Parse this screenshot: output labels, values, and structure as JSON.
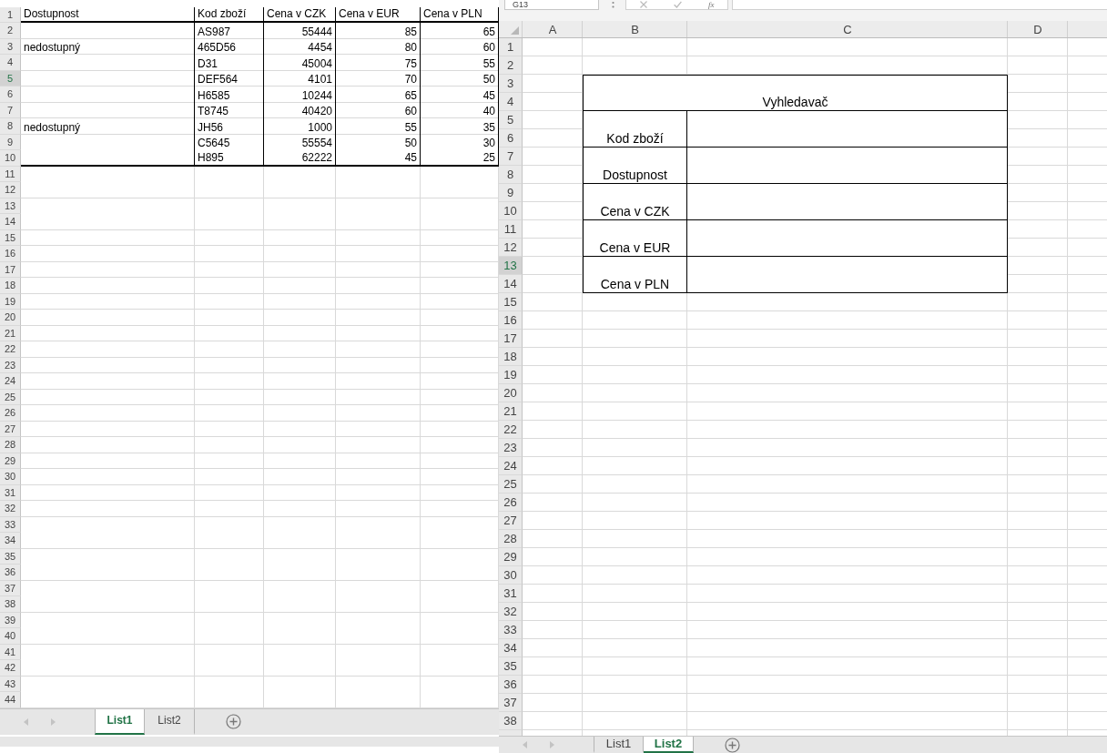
{
  "left_sheet": {
    "row_numbers": [
      {
        "label": "1",
        "selected": false
      },
      {
        "label": "2",
        "selected": false
      },
      {
        "label": "3",
        "selected": false
      },
      {
        "label": "4",
        "selected": false
      },
      {
        "label": "5",
        "selected": true
      },
      {
        "label": "6",
        "selected": false
      },
      {
        "label": "7",
        "selected": false
      },
      {
        "label": "8",
        "selected": false
      },
      {
        "label": "9",
        "selected": false
      },
      {
        "label": "10",
        "selected": false
      },
      {
        "label": "11",
        "selected": false
      },
      {
        "label": "12",
        "selected": false
      },
      {
        "label": "13",
        "selected": false
      },
      {
        "label": "14",
        "selected": false
      },
      {
        "label": "15",
        "selected": false
      },
      {
        "label": "16",
        "selected": false
      },
      {
        "label": "17",
        "selected": false
      },
      {
        "label": "18",
        "selected": false
      },
      {
        "label": "19",
        "selected": false
      },
      {
        "label": "20",
        "selected": false
      },
      {
        "label": "21",
        "selected": false
      },
      {
        "label": "22",
        "selected": false
      },
      {
        "label": "23",
        "selected": false
      },
      {
        "label": "24",
        "selected": false
      },
      {
        "label": "25",
        "selected": false
      },
      {
        "label": "26",
        "selected": false
      },
      {
        "label": "27",
        "selected": false
      },
      {
        "label": "28",
        "selected": false
      },
      {
        "label": "29",
        "selected": false
      },
      {
        "label": "30",
        "selected": false
      },
      {
        "label": "31",
        "selected": false
      },
      {
        "label": "32",
        "selected": false
      },
      {
        "label": "33",
        "selected": false
      },
      {
        "label": "34",
        "selected": false
      },
      {
        "label": "35",
        "selected": false
      },
      {
        "label": "36",
        "selected": false
      },
      {
        "label": "37",
        "selected": false
      },
      {
        "label": "38",
        "selected": false
      },
      {
        "label": "39",
        "selected": false
      },
      {
        "label": "40",
        "selected": false
      },
      {
        "label": "41",
        "selected": false
      },
      {
        "label": "42",
        "selected": false
      },
      {
        "label": "43",
        "selected": false
      },
      {
        "label": "44",
        "selected": false
      }
    ],
    "table": {
      "columns": [
        "Dostupnost",
        "Kod zboží",
        "Cena v CZK",
        "Cena v EUR",
        "Cena v PLN"
      ],
      "rows": [
        {
          "code": "AS987",
          "price_czk": "55444",
          "price_eur": "85",
          "price_pln": "65"
        },
        {
          "availability": "nedostupný",
          "code": "465D56",
          "price_czk": "4454",
          "price_eur": "80",
          "price_pln": "60"
        },
        {
          "code": "D31",
          "price_czk": "45004",
          "price_eur": "75",
          "price_pln": "55"
        },
        {
          "code": "DEF564",
          "price_czk": "4101",
          "price_eur": "70",
          "price_pln": "50"
        },
        {
          "code": "H6585",
          "price_czk": "10244",
          "price_eur": "65",
          "price_pln": "45"
        },
        {
          "code": "T8745",
          "price_czk": "40420",
          "price_eur": "60",
          "price_pln": "40"
        },
        {
          "availability": "nedostupný",
          "code": "JH56",
          "price_czk": "1000",
          "price_eur": "55",
          "price_pln": "35"
        },
        {
          "code": "C5645",
          "price_czk": "55554",
          "price_eur": "50",
          "price_pln": "30"
        },
        {
          "code": "H895",
          "price_czk": "62222",
          "price_eur": "45",
          "price_pln": "25"
        }
      ]
    },
    "tabs": [
      {
        "label": "List1",
        "selected": true
      },
      {
        "label": "List2",
        "selected": false
      }
    ]
  },
  "right_sheet": {
    "formula_bar": {
      "name_box": "G13",
      "function_label": "fx"
    },
    "columns": [
      "A",
      "B",
      "C",
      "D"
    ],
    "row_numbers": [
      {
        "label": "1",
        "selected": false
      },
      {
        "label": "2",
        "selected": false
      },
      {
        "label": "3",
        "selected": false
      },
      {
        "label": "4",
        "selected": false
      },
      {
        "label": "5",
        "selected": false
      },
      {
        "label": "6",
        "selected": false
      },
      {
        "label": "7",
        "selected": false
      },
      {
        "label": "8",
        "selected": false
      },
      {
        "label": "9",
        "selected": false
      },
      {
        "label": "10",
        "selected": false
      },
      {
        "label": "11",
        "selected": false
      },
      {
        "label": "12",
        "selected": false
      },
      {
        "label": "13",
        "selected": true
      },
      {
        "label": "14",
        "selected": false
      },
      {
        "label": "15",
        "selected": false
      },
      {
        "label": "16",
        "selected": false
      },
      {
        "label": "17",
        "selected": false
      },
      {
        "label": "18",
        "selected": false
      },
      {
        "label": "19",
        "selected": false
      },
      {
        "label": "20",
        "selected": false
      },
      {
        "label": "21",
        "selected": false
      },
      {
        "label": "22",
        "selected": false
      },
      {
        "label": "23",
        "selected": false
      },
      {
        "label": "24",
        "selected": false
      },
      {
        "label": "25",
        "selected": false
      },
      {
        "label": "26",
        "selected": false
      },
      {
        "label": "27",
        "selected": false
      },
      {
        "label": "28",
        "selected": false
      },
      {
        "label": "29",
        "selected": false
      },
      {
        "label": "30",
        "selected": false
      },
      {
        "label": "31",
        "selected": false
      },
      {
        "label": "32",
        "selected": false
      },
      {
        "label": "33",
        "selected": false
      },
      {
        "label": "34",
        "selected": false
      },
      {
        "label": "35",
        "selected": false
      },
      {
        "label": "36",
        "selected": false
      },
      {
        "label": "37",
        "selected": false
      },
      {
        "label": "38",
        "selected": false
      }
    ],
    "lookup": {
      "title": "Vyhledavač",
      "fields": [
        "Kod zboží",
        "Dostupnost",
        "Cena v CZK",
        "Cena v EUR",
        "Cena v PLN"
      ]
    },
    "tabs": [
      {
        "label": "List1",
        "selected": false
      },
      {
        "label": "List2",
        "selected": true
      }
    ]
  }
}
